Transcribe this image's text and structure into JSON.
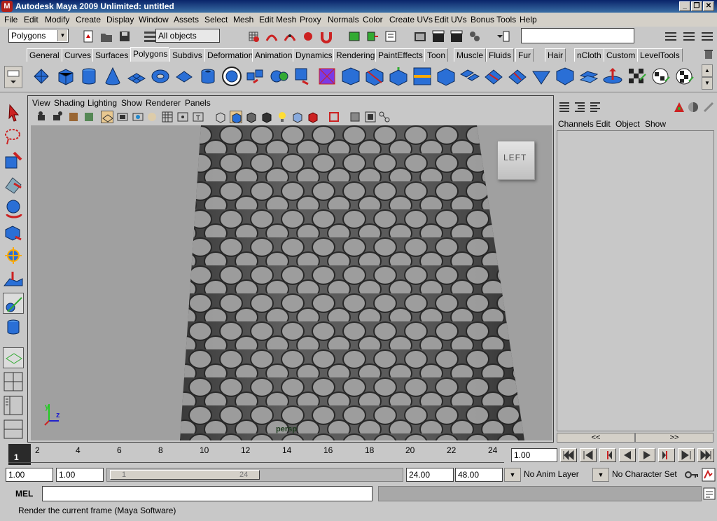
{
  "title": "Autodesk Maya 2009 Unlimited: untitled",
  "menu": [
    "File",
    "Edit",
    "Modify",
    "Create",
    "Display",
    "Window",
    "Assets",
    "Select",
    "Mesh",
    "Edit Mesh",
    "Proxy",
    "Normals",
    "Color",
    "Create UVs",
    "Edit UVs",
    "Bonus Tools",
    "Help"
  ],
  "status": {
    "menuset": "Polygons",
    "selection_mask": "All objects"
  },
  "shelf_tabs": [
    "General",
    "Curves",
    "Surfaces",
    "Polygons",
    "Subdivs",
    "Deformation",
    "Animation",
    "Dynamics",
    "Rendering",
    "PaintEffects",
    "Toon",
    "Muscle",
    "Fluids",
    "Fur",
    "Hair",
    "nCloth",
    "Custom",
    "LevelTools"
  ],
  "active_shelf": "Polygons",
  "panel_menu": [
    "View",
    "Shading",
    "Lighting",
    "Show",
    "Renderer",
    "Panels"
  ],
  "viewcube_label": "LEFT",
  "camera_label": "persp",
  "axis": {
    "y": "y",
    "z": "z"
  },
  "channel_box": {
    "menu": [
      "Channels",
      "Edit",
      "Object",
      "Show"
    ],
    "collapse_left": "<<",
    "collapse_right": ">>"
  },
  "time": {
    "current_frame": "1",
    "ticks": [
      "2",
      "4",
      "6",
      "8",
      "10",
      "12",
      "14",
      "16",
      "18",
      "20",
      "22",
      "24"
    ],
    "current_time_field": "1.00"
  },
  "range": {
    "start": "1.00",
    "playback_start": "1.00",
    "slider_start": "1",
    "slider_end": "24",
    "playback_end": "24.00",
    "end": "48.00",
    "anim_layer": "No Anim Layer",
    "character_set": "No Character Set"
  },
  "command_line": {
    "label": "MEL",
    "value": ""
  },
  "help_line": "Render the current frame (Maya Software)"
}
